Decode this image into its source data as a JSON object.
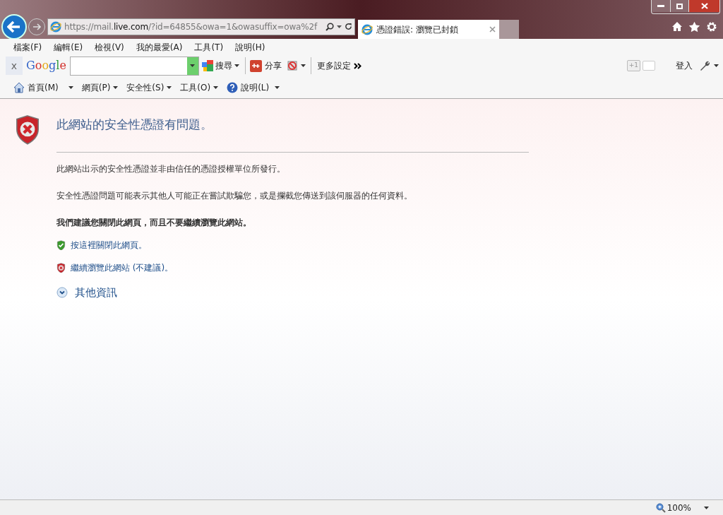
{
  "address_bar": {
    "url_parts": [
      {
        "text": "https://mail.",
        "highlight": false
      },
      {
        "text": "live.com",
        "highlight": true
      },
      {
        "text": "/?id=64855&owa=1&owasuffix=owa%2f",
        "highlight": false
      }
    ]
  },
  "tabs": [
    {
      "title": "憑證錯誤: 瀏覽已封鎖",
      "selected": true
    }
  ],
  "menu_bar": [
    "檔案(F)",
    "編輯(E)",
    "檢視(V)",
    "我的最愛(A)",
    "工具(T)",
    "說明(H)"
  ],
  "google_toolbar": {
    "close": "x",
    "logo": "Google",
    "search_button": "搜尋",
    "share_button": "分享",
    "more": "更多設定",
    "plus_one": "+1",
    "sign_in": "登入"
  },
  "command_bar": [
    {
      "label": "首頁(M)",
      "kind": "home"
    },
    {
      "label": "網頁(P)",
      "kind": "menu"
    },
    {
      "label": "安全性(S)",
      "kind": "menu"
    },
    {
      "label": "工具(O)",
      "kind": "menu"
    },
    {
      "label": "說明(L)",
      "kind": "help"
    }
  ],
  "content": {
    "title": "此網站的安全性憑證有問題。",
    "paragraphs": [
      "此網站出示的安全性憑證並非由信任的憑證授權單位所發行。",
      "安全性憑證問題可能表示其他人可能正在嘗試欺騙您，或是攔截您傳送到該伺服器的任何資料。"
    ],
    "recommendation": "我們建議您關閉此網頁，而且不要繼續瀏覽此網站。",
    "links": [
      {
        "text": "按這裡關閉此網頁。",
        "kind": "safe"
      },
      {
        "text": "繼續瀏覽此網站 (不建議)。",
        "kind": "unsafe"
      }
    ],
    "more_info": {
      "label": "其他資訊",
      "expanded": false
    }
  },
  "status_bar": {
    "zoom": "100%"
  }
}
